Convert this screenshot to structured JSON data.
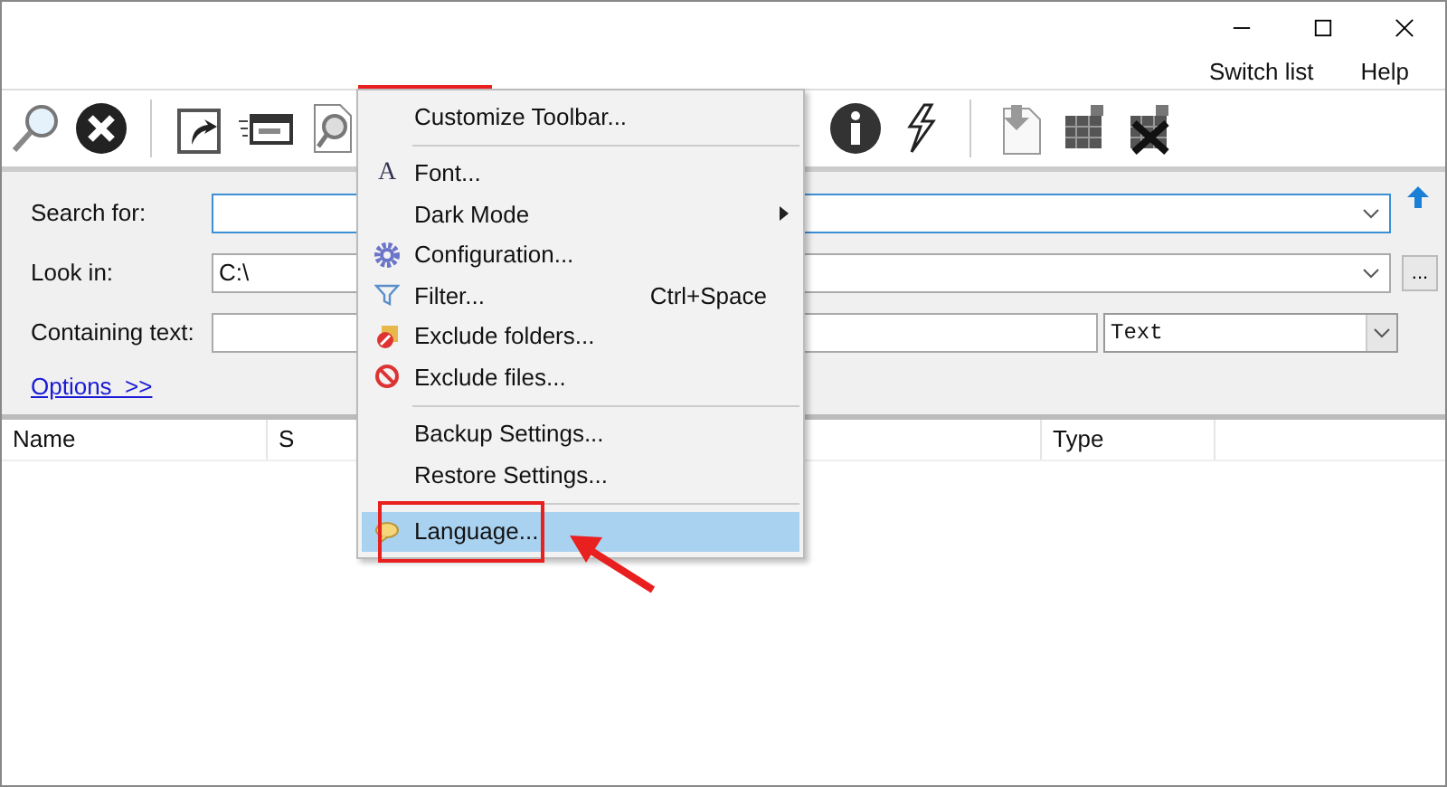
{
  "menu_bar": {
    "items": [
      "Switch list",
      "Help"
    ]
  },
  "form": {
    "search_for": {
      "label": "Search for:"
    },
    "look_in": {
      "label": "Look in:",
      "value": "C:\\",
      "browse": "..."
    },
    "containing_text": {
      "label": "Containing text:",
      "mode": "Text"
    },
    "options_link": "Options  >>"
  },
  "list": {
    "columns": [
      "Name",
      "S",
      "Type"
    ]
  },
  "context_menu": {
    "items": [
      {
        "kind": "item",
        "label": "Customize Toolbar...",
        "selected": false
      },
      {
        "kind": "separator"
      },
      {
        "kind": "item",
        "icon_text": "A",
        "label": "Font...",
        "selected": false
      },
      {
        "kind": "item",
        "label": "Dark Mode",
        "submenu": true,
        "selected": false
      },
      {
        "kind": "item",
        "label": "Configuration...",
        "selected": false
      },
      {
        "kind": "item",
        "label": "Filter...",
        "shortcut": "Ctrl+Space",
        "selected": false
      },
      {
        "kind": "item",
        "label": "Exclude folders...",
        "selected": false
      },
      {
        "kind": "item",
        "label": "Exclude files...",
        "selected": false
      },
      {
        "kind": "separator"
      },
      {
        "kind": "item",
        "label": "Backup Settings...",
        "selected": false
      },
      {
        "kind": "item",
        "label": "Restore Settings...",
        "selected": false
      },
      {
        "kind": "separator"
      },
      {
        "kind": "item",
        "label": "Language...",
        "selected": true
      }
    ]
  }
}
